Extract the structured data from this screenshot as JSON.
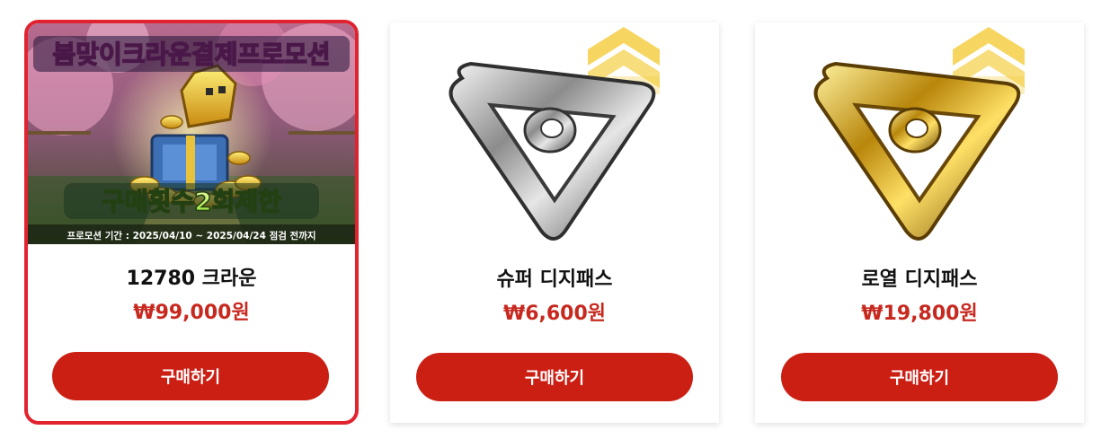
{
  "products": [
    {
      "name": "12780 크라운",
      "price": "₩99,000원",
      "button": "구매하기",
      "image_icon": "crown-chest-banner",
      "banner": {
        "headline": "봄맞이크라운결제프로모션",
        "limit_text": "구매횟수2회제한",
        "period_text": "프로모션 기간 : 2025/04/10 ~ 2025/04/24 점검 전까지"
      }
    },
    {
      "name": "슈퍼 디지패스",
      "price": "₩6,600원",
      "button": "구매하기",
      "image_icon": "silver-pass-emblem"
    },
    {
      "name": "로열 디지패스",
      "price": "₩19,800원",
      "button": "구매하기",
      "image_icon": "gold-pass-emblem"
    }
  ],
  "colors": {
    "accent": "#cc1f14",
    "price": "#c7291f",
    "selected_border": "#e0232f"
  }
}
